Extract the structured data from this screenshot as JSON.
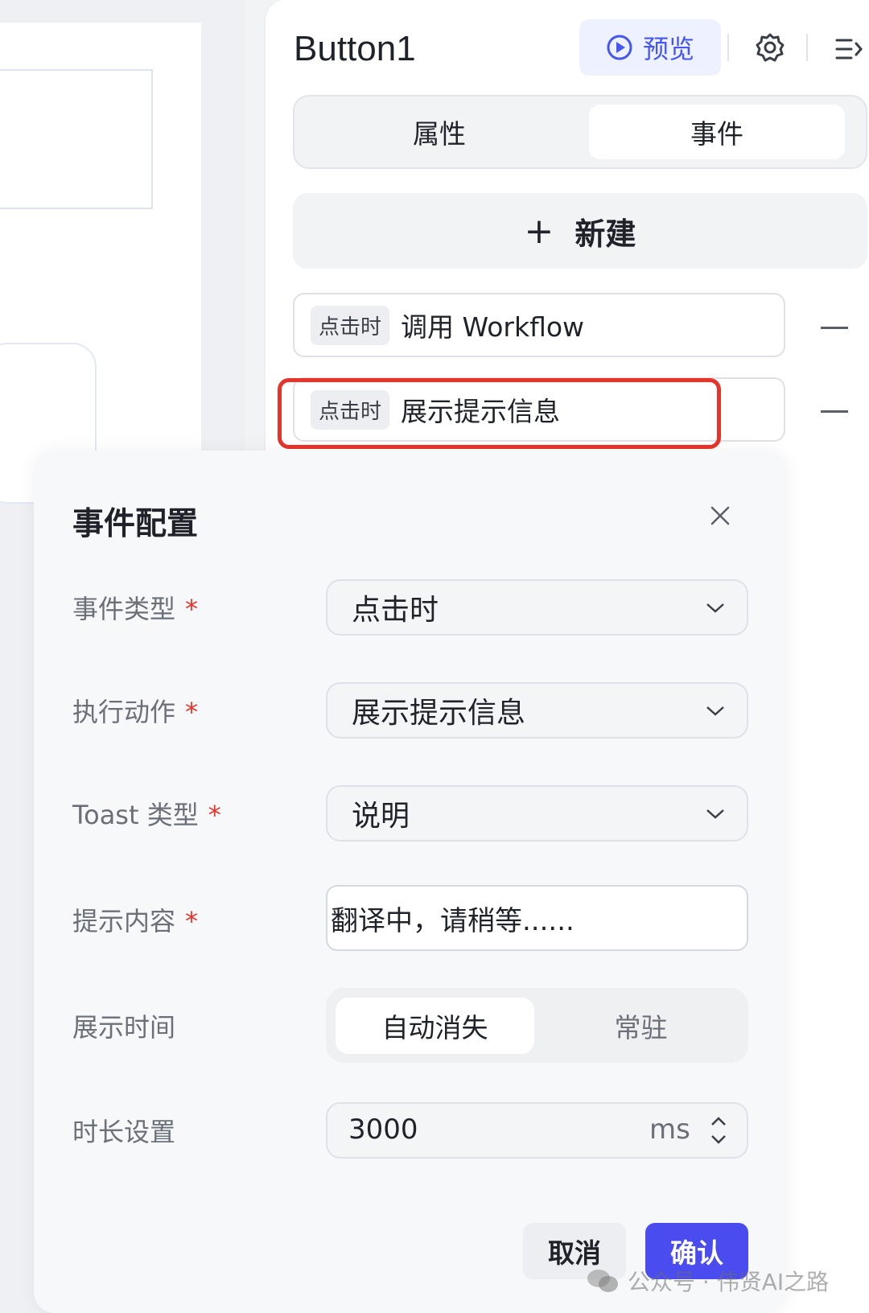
{
  "header": {
    "title": "Button1",
    "preview_label": "预览"
  },
  "tabs": [
    {
      "label": "属性"
    },
    {
      "label": "事件"
    }
  ],
  "new_button": {
    "plus": "+",
    "label": "新建"
  },
  "events": [
    {
      "trigger": "点击时",
      "action": "调用 Workflow"
    },
    {
      "trigger": "点击时",
      "action": "展示提示信息"
    }
  ],
  "modal": {
    "title": "事件配置",
    "required_mark": "*",
    "fields": {
      "event_type": {
        "label": "事件类型",
        "value": "点击时"
      },
      "action": {
        "label": "执行动作",
        "value": "展示提示信息"
      },
      "toast_type": {
        "label": "Toast 类型",
        "value": "说明"
      },
      "content": {
        "label": "提示内容",
        "value": "翻译中，请稍等......"
      },
      "display_time": {
        "label": "展示时间",
        "options": [
          "自动消失",
          "常驻"
        ],
        "selected": "自动消失"
      },
      "duration": {
        "label": "时长设置",
        "value": "3000",
        "unit": "ms"
      }
    },
    "cancel_label": "取消",
    "confirm_label": "确认"
  },
  "watermark": {
    "text": "公众号 · 伟贤AI之路"
  },
  "colors": {
    "accent": "#4a4cf0",
    "highlight": "#e8332a",
    "required": "#e8332a"
  }
}
